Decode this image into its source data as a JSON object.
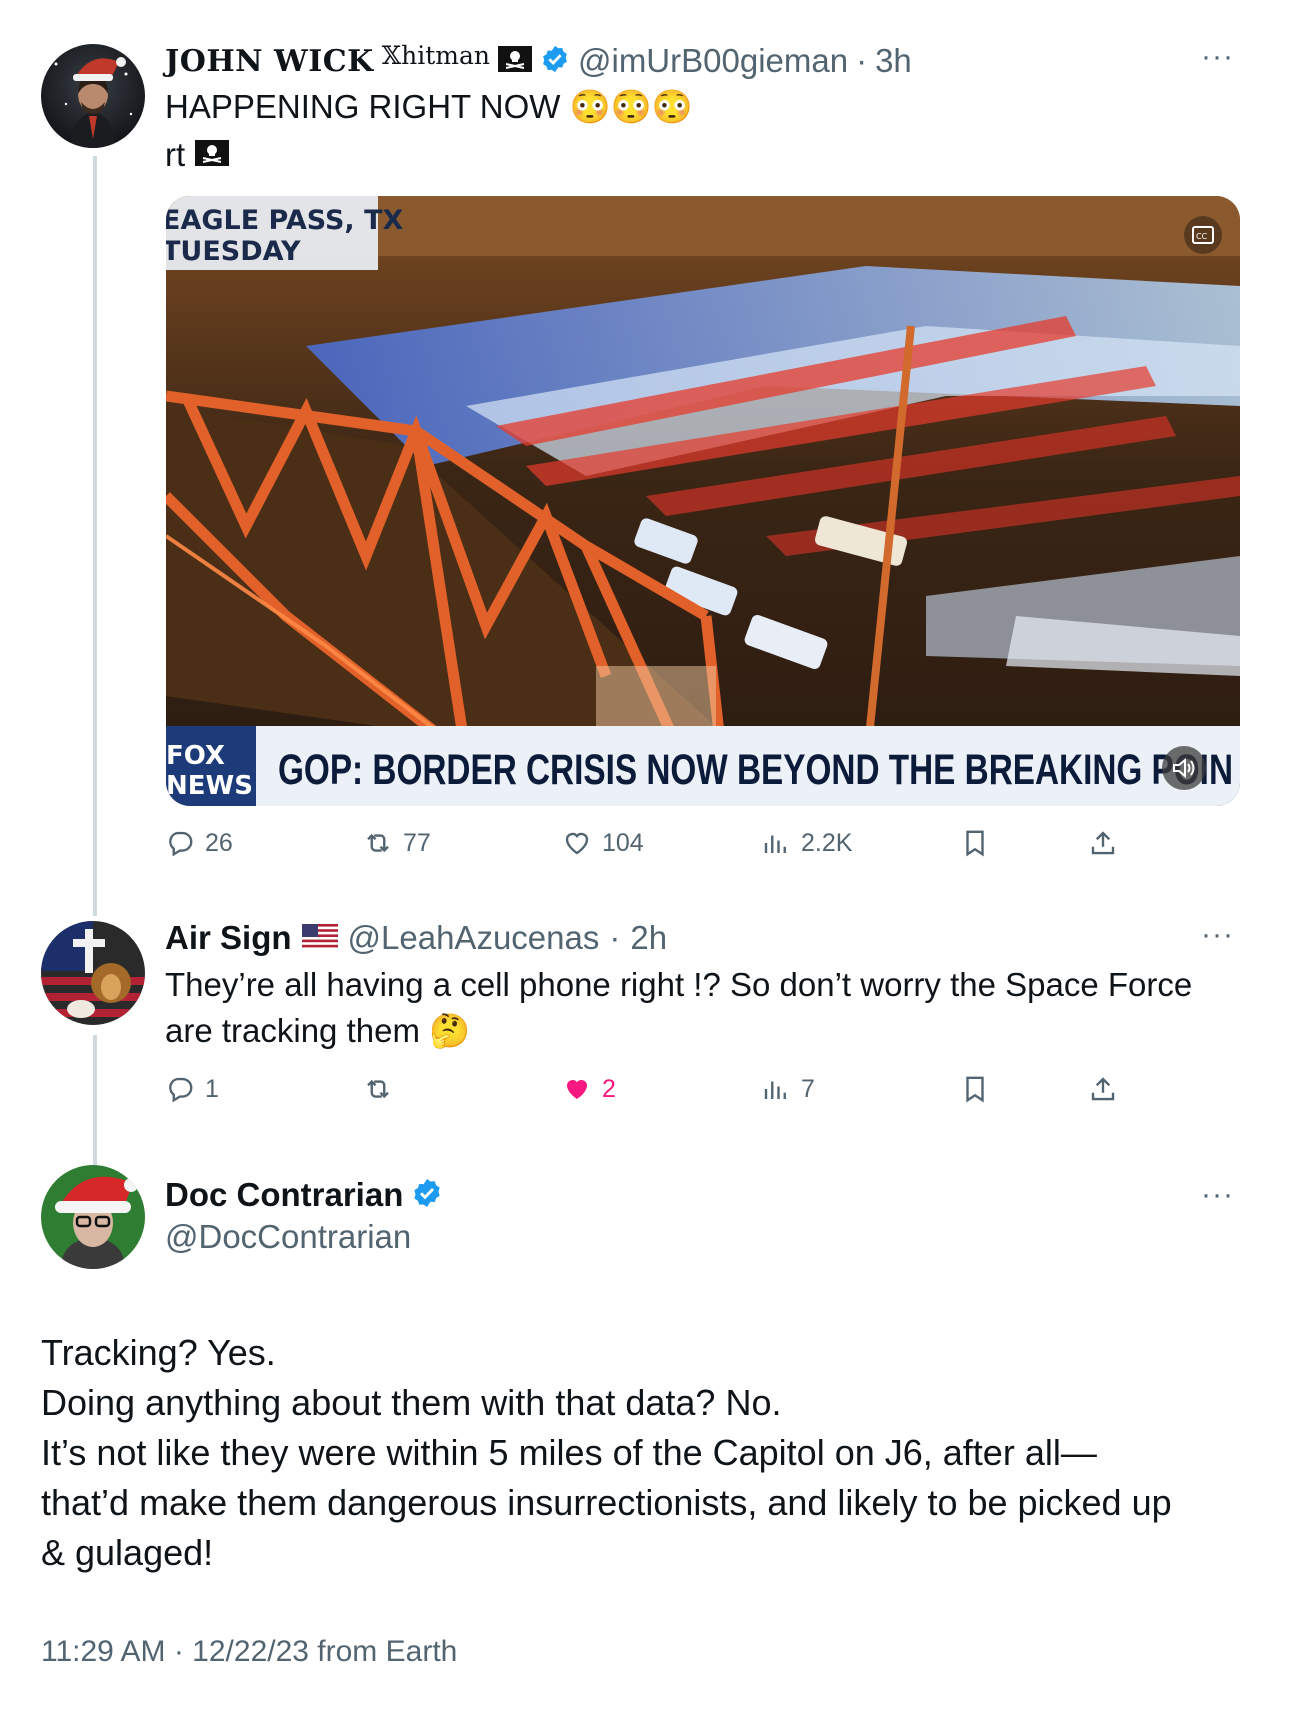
{
  "tweet1": {
    "display_name": "JOHN WICK",
    "name_suffix": "𝕏hitman",
    "handle": "@imUrB00gieman",
    "time": "3h",
    "text_line1": "HAPPENING RIGHT NOW 😳😳😳",
    "text_line2": "rt",
    "media": {
      "location_tag_line1": "EAGLE PASS, TX",
      "location_tag_line2": "TUESDAY",
      "network_logo_line1": "FOX",
      "network_logo_line2": "NEWS",
      "chyron": "GOP: BORDER CRISIS NOW BEYOND THE BREAKING POIN"
    },
    "actions": {
      "replies": "26",
      "reposts": "77",
      "likes": "104",
      "views": "2.2K"
    }
  },
  "tweet2": {
    "display_name": "Air Sign",
    "handle": "@LeahAzucenas",
    "time": "2h",
    "text_line1": "They’re all having a cell phone right !? So don’t worry the Space Force",
    "text_line2": "are tracking them 🤔",
    "actions": {
      "replies": "1",
      "reposts": "",
      "likes": "2",
      "views": "7"
    }
  },
  "tweet3": {
    "display_name": "Doc Contrarian",
    "handle": "@DocContrarian",
    "text_lines": [
      "Tracking? Yes.",
      "Doing anything about them with that data? No.",
      "It’s not like they were within 5 miles of the Capitol on J6, after all—",
      "that’d make them dangerous insurrectionists, and likely to be picked up",
      "& gulaged!"
    ],
    "timestamp": "11:29 AM · 12/22/23 from Earth"
  },
  "icons": [
    "more-icon",
    "verified-icon",
    "pirate-flag-icon",
    "us-flag-icon",
    "reply-icon",
    "repost-icon",
    "like-icon",
    "views-icon",
    "bookmark-icon",
    "share-icon",
    "captions-icon",
    "volume-icon"
  ],
  "colors": {
    "verified": "#1d9bf0",
    "like_active": "#f91880",
    "muted": "#536471",
    "thread_line": "#cfd9de"
  }
}
